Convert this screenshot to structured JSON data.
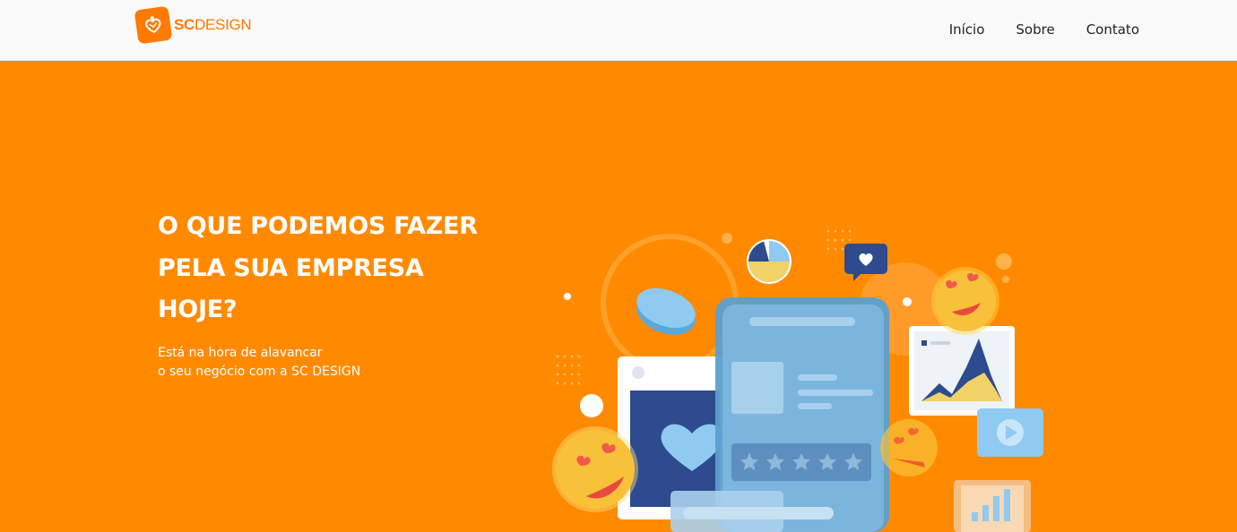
{
  "brand": {
    "name_bold": "SC",
    "name_light": "DESIGN",
    "accent": "#ff7a00",
    "hero_bg": "#ff8a00"
  },
  "nav": {
    "items": [
      {
        "label": "Início"
      },
      {
        "label": "Sobre"
      },
      {
        "label": "Contato"
      }
    ]
  },
  "hero": {
    "title_lines": [
      "O QUE PODEMOS FAZER",
      "PELA SUA EMPRESA",
      "HOJE?"
    ],
    "subtitle_lines": [
      "Está na hora de alavancar",
      "o seu negócio com a SC DESIGN"
    ]
  },
  "illustration": {
    "icons": [
      "pie-chart-icon",
      "heart-bubble-icon",
      "heart-eyes-emoji-icon",
      "area-chart-icon",
      "play-icon",
      "bar-chart-icon",
      "star-rating-icon"
    ],
    "rating_stars": 5
  }
}
